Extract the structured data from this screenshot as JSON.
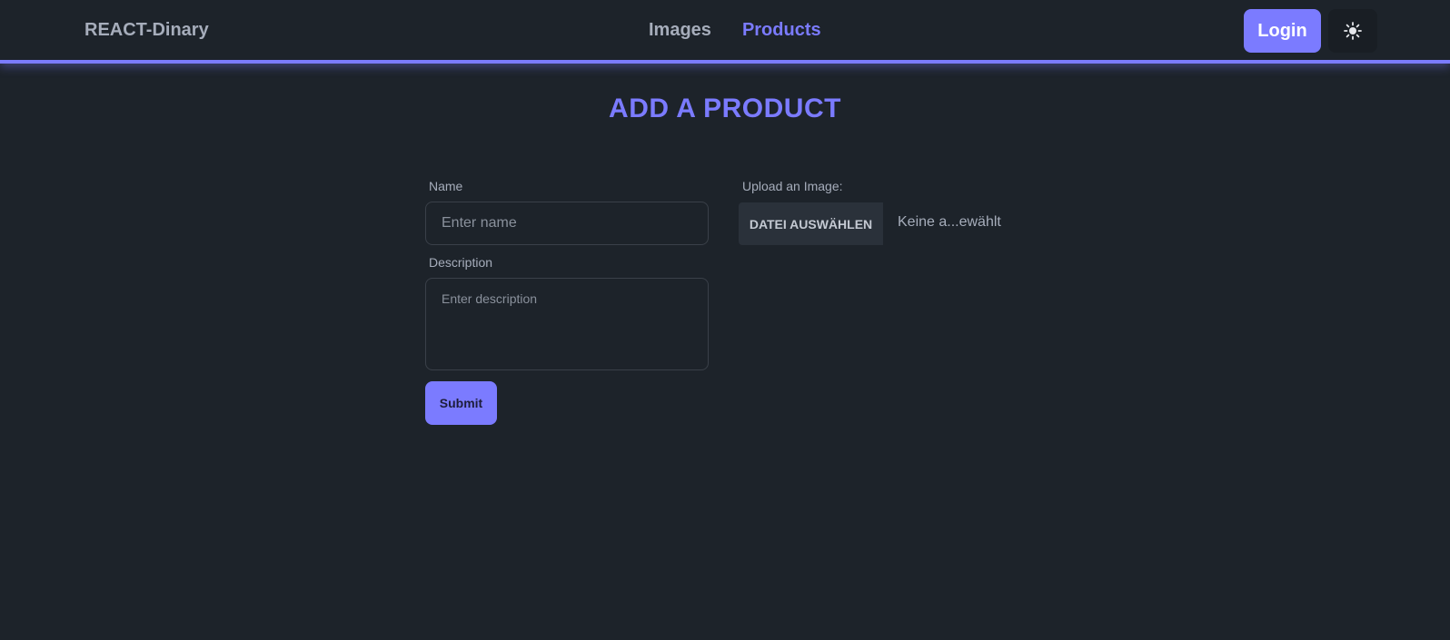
{
  "header": {
    "brand": "REACT-Dinary",
    "nav": [
      {
        "label": "Images",
        "active": false
      },
      {
        "label": "Products",
        "active": true
      }
    ],
    "login_label": "Login",
    "theme_icon": "sun-icon"
  },
  "page": {
    "title": "ADD A PRODUCT"
  },
  "form": {
    "name_label": "Name",
    "name_placeholder": "Enter name",
    "name_value": "",
    "description_label": "Description",
    "description_placeholder": "Enter description",
    "description_value": "",
    "submit_label": "Submit",
    "upload_label": "Upload an Image:",
    "file_button_label": "DATEI AUSWÄHLEN",
    "file_status": "Keine a...ewählt"
  },
  "colors": {
    "accent": "#7b7bff",
    "background": "#1d232a",
    "text": "#a6adbb"
  }
}
